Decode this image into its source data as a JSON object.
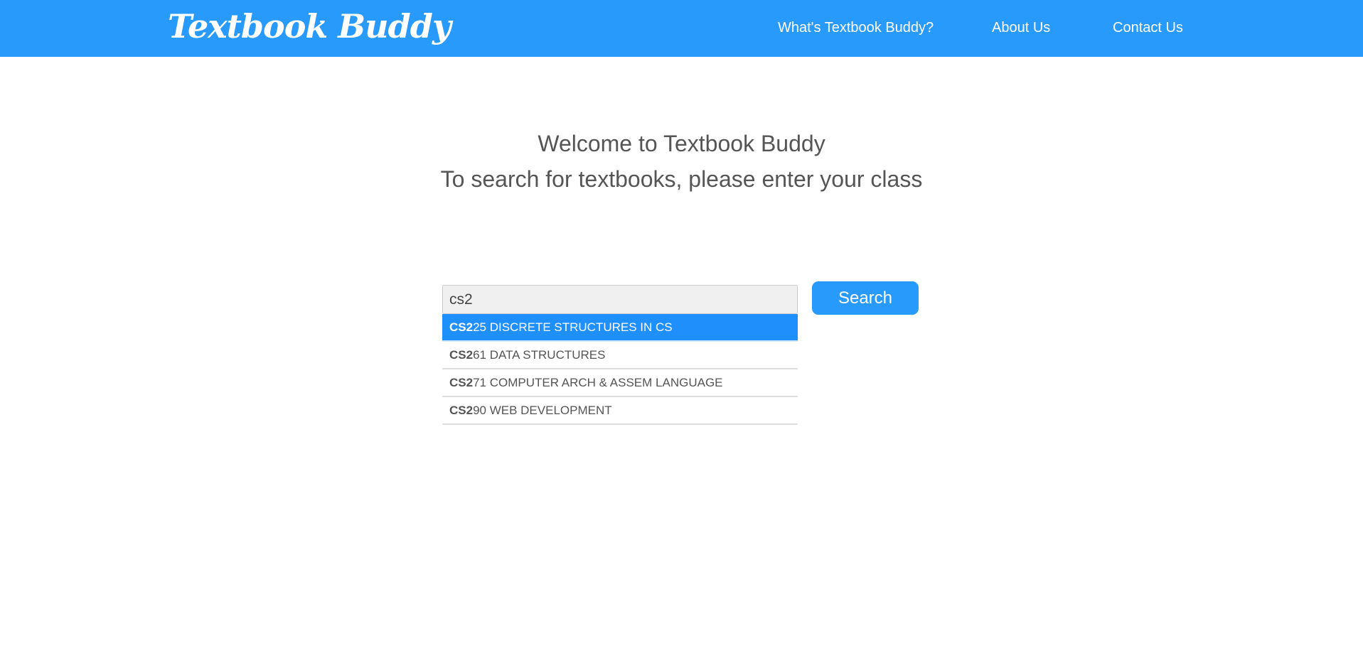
{
  "header": {
    "logo": "Textbook Buddy",
    "nav": [
      "What's Textbook Buddy?",
      "About Us",
      "Contact Us"
    ]
  },
  "main": {
    "welcome": "Welcome to Textbook Buddy",
    "instruction": "To search for textbooks, please enter your class"
  },
  "search": {
    "value": "cs2",
    "button": "Search"
  },
  "suggestions": [
    {
      "match": "CS2",
      "rest": "25 DISCRETE STRUCTURES IN CS",
      "active": true
    },
    {
      "match": "CS2",
      "rest": "61 DATA STRUCTURES"
    },
    {
      "match": "CS2",
      "rest": "71 COMPUTER ARCH & ASSEM LANGUAGE"
    },
    {
      "match": "CS2",
      "rest": "90 WEB DEVELOPMENT"
    }
  ],
  "colors": {
    "brand": "#289afc",
    "highlight": "#1f8ffc"
  }
}
